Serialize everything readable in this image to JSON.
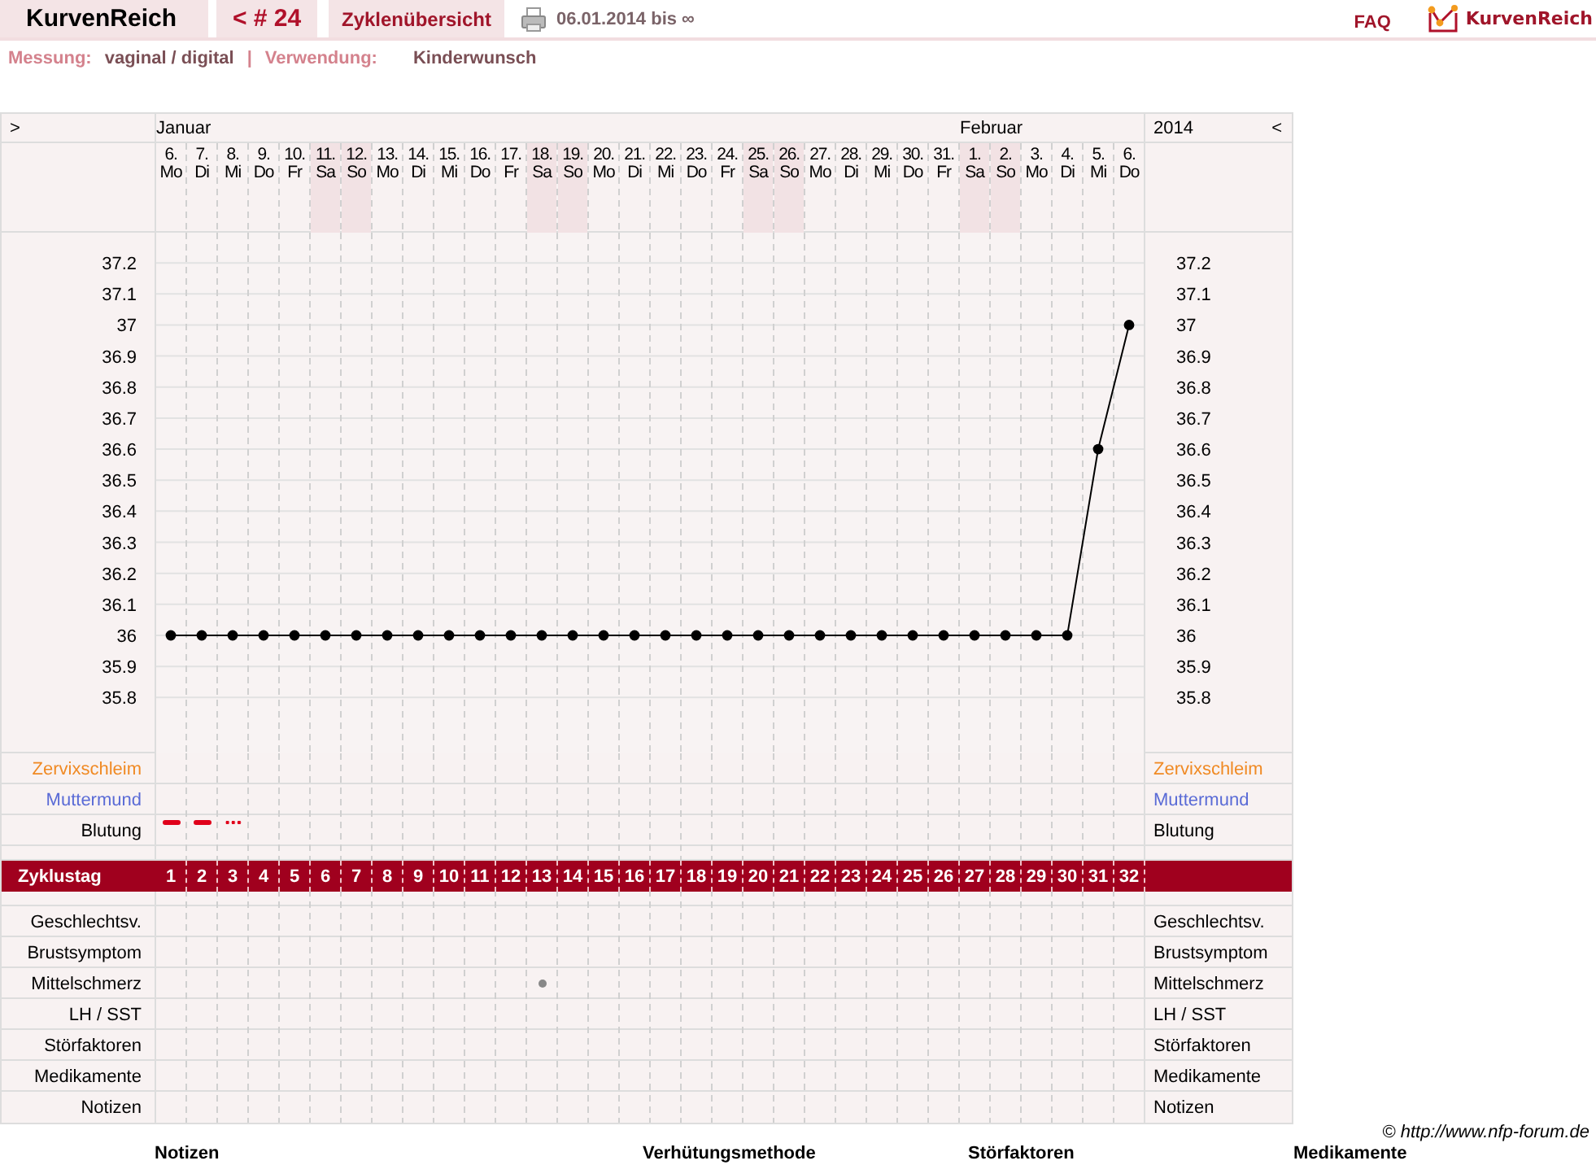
{
  "topbar": {
    "app_title": "KurvenReich",
    "cycle_nav": "< # 24",
    "overview_tab": "Zyklenübersicht",
    "date_range": "06.01.2014 bis ∞",
    "faq": "FAQ",
    "brand": "KurvenReich"
  },
  "info": {
    "measure_label": "Messung:",
    "measure_value": "vaginal / digital",
    "separator": "|",
    "usage_label": "Verwendung:",
    "usage_value": "Kinderwunsch"
  },
  "sheet": {
    "prev": ">",
    "next": "<",
    "year": "2014",
    "months": [
      {
        "name": "Januar",
        "days": [
          {
            "date": "6.",
            "weekday": "Mo",
            "weekend": false,
            "bleeding": {
              "kind": "heavy"
            },
            "mittelschmerz": false
          },
          {
            "date": "7.",
            "weekday": "Di",
            "weekend": false,
            "bleeding": {
              "kind": "heavy"
            },
            "mittelschmerz": false
          },
          {
            "date": "8.",
            "weekday": "Mi",
            "weekend": false,
            "bleeding": {
              "kind": "spotting"
            },
            "mittelschmerz": false
          },
          {
            "date": "9.",
            "weekday": "Do",
            "weekend": false,
            "mittelschmerz": false
          },
          {
            "date": "10.",
            "weekday": "Fr",
            "weekend": false,
            "mittelschmerz": false
          },
          {
            "date": "11.",
            "weekday": "Sa",
            "weekend": true,
            "mittelschmerz": false
          },
          {
            "date": "12.",
            "weekday": "So",
            "weekend": true,
            "mittelschmerz": false
          },
          {
            "date": "13.",
            "weekday": "Mo",
            "weekend": false,
            "mittelschmerz": false
          },
          {
            "date": "14.",
            "weekday": "Di",
            "weekend": false,
            "mittelschmerz": false
          },
          {
            "date": "15.",
            "weekday": "Mi",
            "weekend": false,
            "mittelschmerz": false
          },
          {
            "date": "16.",
            "weekday": "Do",
            "weekend": false,
            "mittelschmerz": false
          },
          {
            "date": "17.",
            "weekday": "Fr",
            "weekend": false,
            "mittelschmerz": false
          },
          {
            "date": "18.",
            "weekday": "Sa",
            "weekend": true,
            "mittelschmerz": true
          },
          {
            "date": "19.",
            "weekday": "So",
            "weekend": true,
            "mittelschmerz": false
          },
          {
            "date": "20.",
            "weekday": "Mo",
            "weekend": false,
            "mittelschmerz": false
          },
          {
            "date": "21.",
            "weekday": "Di",
            "weekend": false,
            "mittelschmerz": false
          },
          {
            "date": "22.",
            "weekday": "Mi",
            "weekend": false,
            "mittelschmerz": false
          },
          {
            "date": "23.",
            "weekday": "Do",
            "weekend": false,
            "mittelschmerz": false
          },
          {
            "date": "24.",
            "weekday": "Fr",
            "weekend": false,
            "mittelschmerz": false
          },
          {
            "date": "25.",
            "weekday": "Sa",
            "weekend": true,
            "mittelschmerz": false
          },
          {
            "date": "26.",
            "weekday": "So",
            "weekend": true,
            "mittelschmerz": false
          },
          {
            "date": "27.",
            "weekday": "Mo",
            "weekend": false,
            "mittelschmerz": false
          },
          {
            "date": "28.",
            "weekday": "Di",
            "weekend": false,
            "mittelschmerz": false
          },
          {
            "date": "29.",
            "weekday": "Mi",
            "weekend": false,
            "mittelschmerz": false
          },
          {
            "date": "30.",
            "weekday": "Do",
            "weekend": false,
            "mittelschmerz": false
          },
          {
            "date": "31.",
            "weekday": "Fr",
            "weekend": false,
            "mittelschmerz": false
          }
        ]
      },
      {
        "name": "Februar",
        "days": [
          {
            "date": "1.",
            "weekday": "Sa",
            "weekend": true,
            "mittelschmerz": false
          },
          {
            "date": "2.",
            "weekday": "So",
            "weekend": true,
            "mittelschmerz": false
          },
          {
            "date": "3.",
            "weekday": "Mo",
            "weekend": false,
            "mittelschmerz": false
          },
          {
            "date": "4.",
            "weekday": "Di",
            "weekend": false,
            "mittelschmerz": false
          },
          {
            "date": "5.",
            "weekday": "Mi",
            "weekend": false,
            "mittelschmerz": false
          },
          {
            "date": "6.",
            "weekday": "Do",
            "weekend": false,
            "mittelschmerz": false
          }
        ]
      }
    ],
    "chart_data": {
      "type": "line",
      "grid": true,
      "ylim": [
        34.43,
        37.68
      ],
      "series": [
        {
          "color": "#000000",
          "marker": true,
          "values": [
            36,
            36,
            36,
            36,
            36,
            36,
            36,
            36,
            36,
            36,
            36,
            36,
            36,
            36,
            36,
            36,
            36,
            36,
            36,
            36,
            36,
            36,
            36,
            36,
            36,
            36,
            36,
            36,
            36,
            36,
            36.6,
            37
          ]
        }
      ],
      "yticks": [
        37.2,
        37.1,
        37,
        36.9,
        36.8,
        36.7,
        36.6,
        36.5,
        36.4,
        36.3,
        36.2,
        36.1,
        36,
        35.9,
        35.8
      ]
    },
    "right_axis_labels": [
      "37.2",
      "37.1",
      "37",
      "36.9",
      "36.8",
      "36.7",
      "36.6",
      "36.5",
      "36.4",
      "36.3",
      "36.2",
      "36.1",
      "36",
      "35.9",
      "35.8"
    ],
    "upper_rows": [
      {
        "kind": "zervix",
        "label_left": "Zervixschleim",
        "label_right": "Zervixschleim"
      },
      {
        "kind": "muttermund",
        "label_left": "Muttermund",
        "label_right": "Muttermund"
      },
      {
        "kind": "bleeding",
        "label_left": "Blutung",
        "label_right": "Blutung"
      }
    ],
    "cycle_day_label": "Zyklustag",
    "cycle_days": [
      "1",
      "2",
      "3",
      "4",
      "5",
      "6",
      "7",
      "8",
      "9",
      "10",
      "11",
      "12",
      "13",
      "14",
      "15",
      "16",
      "17",
      "18",
      "19",
      "20",
      "21",
      "22",
      "23",
      "24",
      "25",
      "26",
      "27",
      "28",
      "29",
      "30",
      "31",
      "32"
    ],
    "lower_rows": [
      {
        "kind": "plain",
        "label_left": "Geschlechtsv.",
        "label_right": "Geschlechtsv."
      },
      {
        "kind": "plain",
        "label_left": "Brustsymptom",
        "label_right": "Brustsymptom"
      },
      {
        "kind": "mittelschmerz",
        "label_left": "Mittelschmerz",
        "label_right": "Mittelschmerz"
      },
      {
        "kind": "plain",
        "label_left": "LH / SST",
        "label_right": "LH / SST"
      },
      {
        "kind": "plain",
        "label_left": "Störfaktoren",
        "label_right": "Störfaktoren"
      },
      {
        "kind": "plain",
        "label_left": "Medikamente",
        "label_right": "Medikamente"
      },
      {
        "kind": "plain",
        "label_left": "Notizen",
        "label_right": "Notizen"
      }
    ]
  },
  "copyright": "© http://www.nfp-forum.de",
  "sections": [
    {
      "title": "Notizen"
    },
    {
      "title": "Verhütungsmethode"
    },
    {
      "title": "Störfaktoren"
    },
    {
      "title": "Medikamente"
    }
  ]
}
